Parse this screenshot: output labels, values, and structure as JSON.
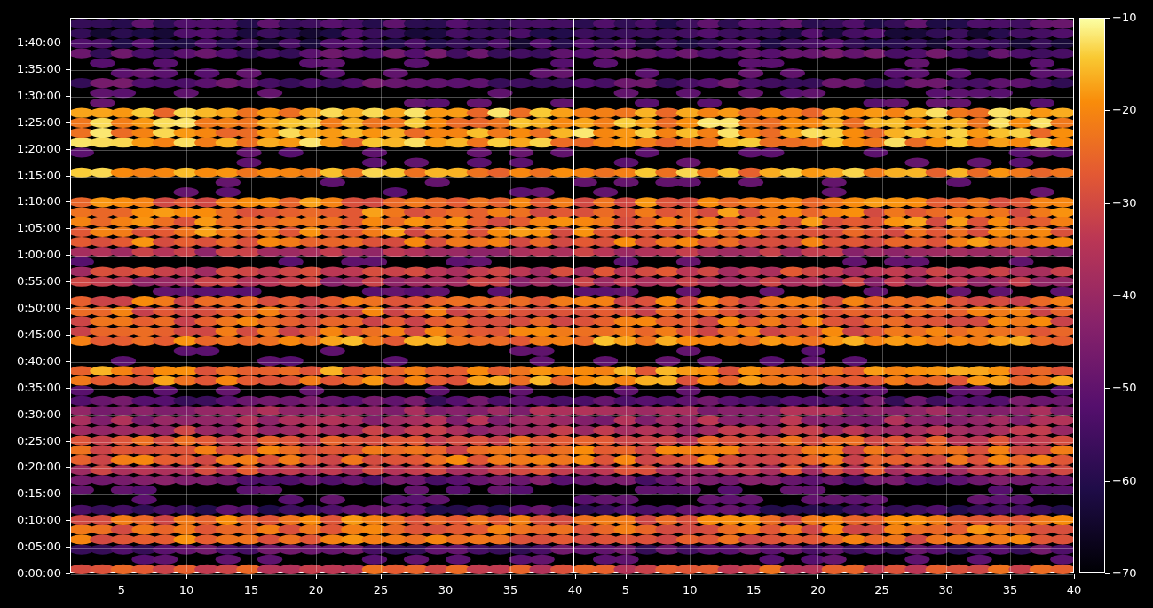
{
  "y_axis": {
    "ticks": [
      "1:40:00",
      "1:35:00",
      "1:30:00",
      "1:25:00",
      "1:20:00",
      "1:15:00",
      "1:10:00",
      "1:05:00",
      "1:00:00",
      "0:55:00",
      "0:50:00",
      "0:45:00",
      "0:40:00",
      "0:35:00",
      "0:30:00",
      "0:25:00",
      "0:20:00",
      "0:15:00",
      "0:10:00",
      "0:05:00",
      "0:00:00"
    ]
  },
  "panels": [
    {
      "x_ticks": [
        "5",
        "10",
        "15",
        "20",
        "25",
        "30",
        "35",
        "40"
      ]
    },
    {
      "x_ticks": [
        "5",
        "10",
        "15",
        "20",
        "25",
        "30",
        "35",
        "40"
      ]
    }
  ],
  "colorbar": {
    "ticks": [
      "−10",
      "−20",
      "−30",
      "−40",
      "−50",
      "−60",
      "−70"
    ]
  }
}
